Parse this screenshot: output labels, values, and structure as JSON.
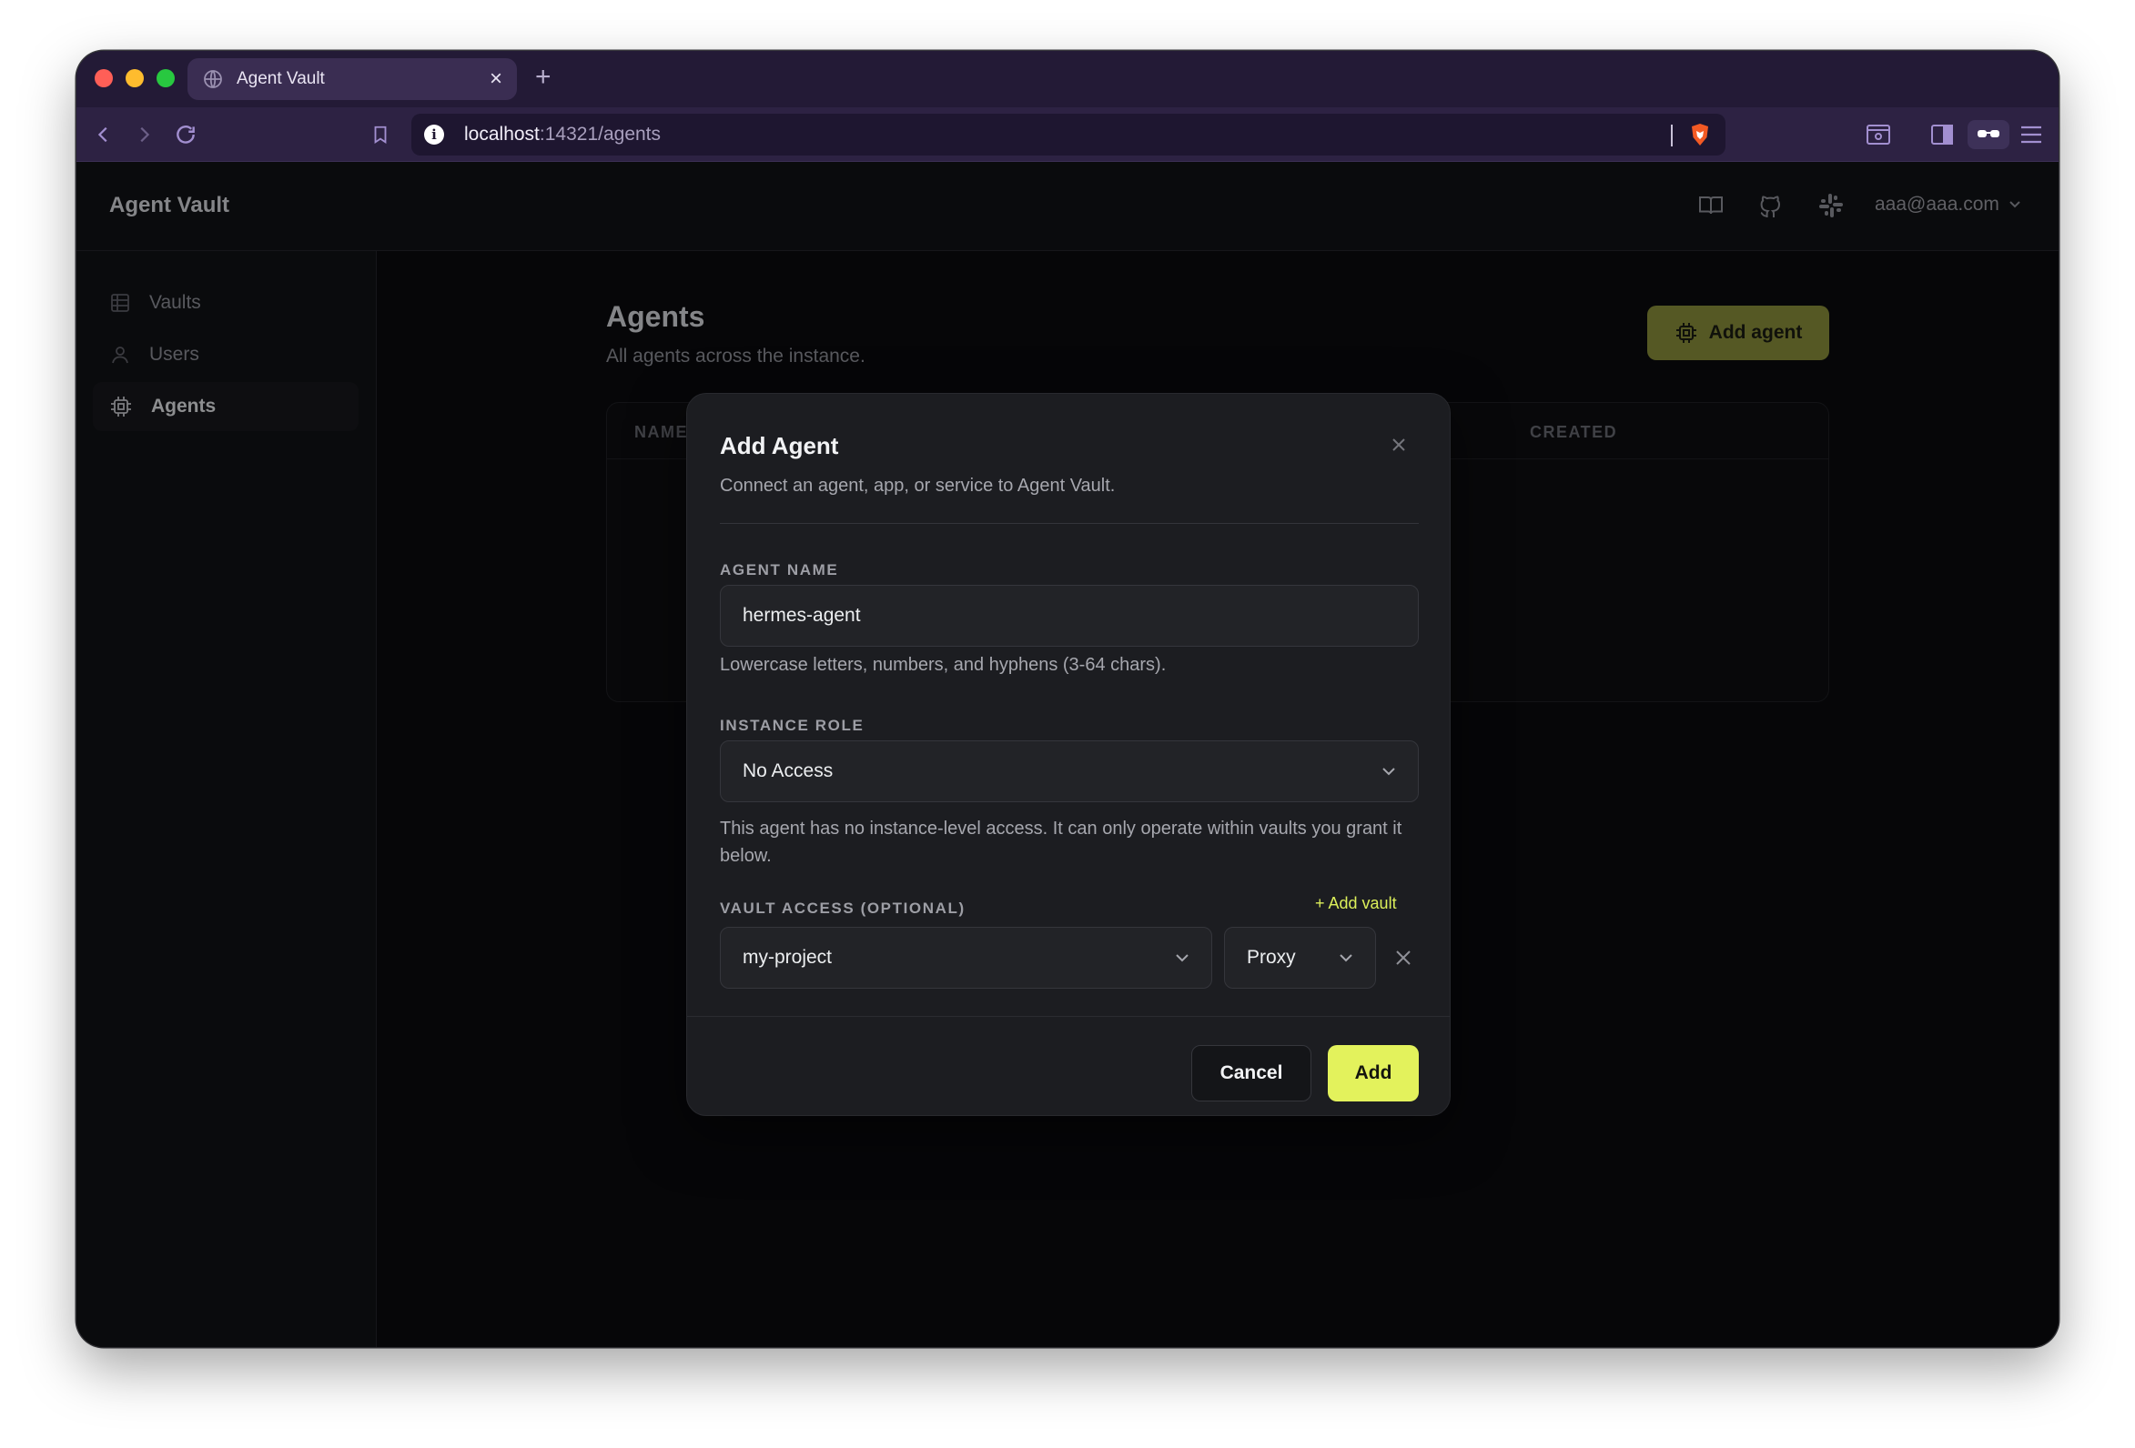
{
  "browser": {
    "tab_title": "Agent Vault",
    "url_host": "localhost",
    "url_path": ":14321/agents"
  },
  "app": {
    "title": "Agent Vault",
    "user_email": "aaa@aaa.com"
  },
  "sidebar": {
    "items": [
      {
        "label": "Vaults",
        "icon": "grid-icon",
        "active": false
      },
      {
        "label": "Users",
        "icon": "user-icon",
        "active": false
      },
      {
        "label": "Agents",
        "icon": "cpu-icon",
        "active": true
      }
    ]
  },
  "page": {
    "title": "Agents",
    "subtitle": "All agents across the instance.",
    "add_button": "Add agent",
    "table_headers": [
      "NAME",
      "CREATED"
    ]
  },
  "modal": {
    "title": "Add Agent",
    "description": "Connect an agent, app, or service to Agent Vault.",
    "agent_name_label": "AGENT NAME",
    "agent_name_value": "hermes-agent",
    "agent_name_hint": "Lowercase letters, numbers, and hyphens (3-64 chars).",
    "instance_role_label": "INSTANCE ROLE",
    "instance_role_value": "No Access",
    "instance_role_hint": "This agent has no instance-level access. It can only operate within vaults you grant it below.",
    "vault_access_label": "VAULT ACCESS (OPTIONAL)",
    "add_vault_link": "+ Add vault",
    "vault_value": "my-project",
    "vault_mode_value": "Proxy",
    "cancel_label": "Cancel",
    "add_label": "Add"
  },
  "colors": {
    "accent": "#e3f25c",
    "accent_dim": "#8a8f3a",
    "browser_chrome": "#2d2243"
  }
}
